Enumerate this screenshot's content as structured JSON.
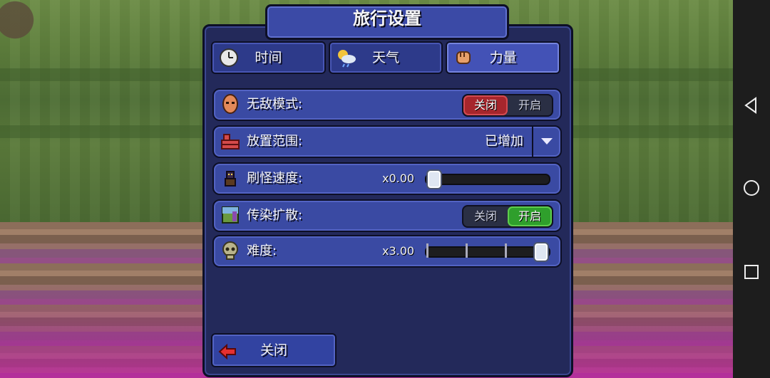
{
  "title": "旅行设置",
  "tabs": [
    {
      "label": "时间",
      "icon": "clock-icon",
      "active": false
    },
    {
      "label": "天气",
      "icon": "weather-icon",
      "active": false
    },
    {
      "label": "力量",
      "icon": "fist-icon",
      "active": true
    }
  ],
  "rows": {
    "godmode": {
      "label": "无敌模式:",
      "off": "关闭",
      "on": "开启",
      "state": "off"
    },
    "placement": {
      "label": "放置范围:",
      "value": "已增加"
    },
    "spawn": {
      "label": "刷怪速度:",
      "value": "x0.00",
      "level": 0.0
    },
    "infection": {
      "label": "传染扩散:",
      "off": "关闭",
      "on": "开启",
      "state": "on"
    },
    "difficulty": {
      "label": "难度:",
      "value": "x3.00",
      "level": 1.0
    }
  },
  "close_button": {
    "label": "关闭"
  },
  "colors": {
    "accent": "#3a4aa3",
    "off_red": "#a6262c",
    "on_green": "#2f9f2c"
  }
}
